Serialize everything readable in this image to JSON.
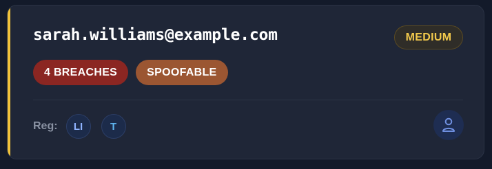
{
  "card": {
    "email": "sarah.williams@example.com",
    "severity": "MEDIUM",
    "tags": [
      {
        "label": "4 BREACHES",
        "color": "#8b2622"
      },
      {
        "label": "SPOOFABLE",
        "color": "#9b5632"
      }
    ],
    "registrations": {
      "label": "Reg:",
      "items": [
        {
          "label": "LI"
        },
        {
          "label": "T"
        }
      ]
    },
    "profile_icon": "user-icon",
    "accent_color": "#f0c23a"
  }
}
